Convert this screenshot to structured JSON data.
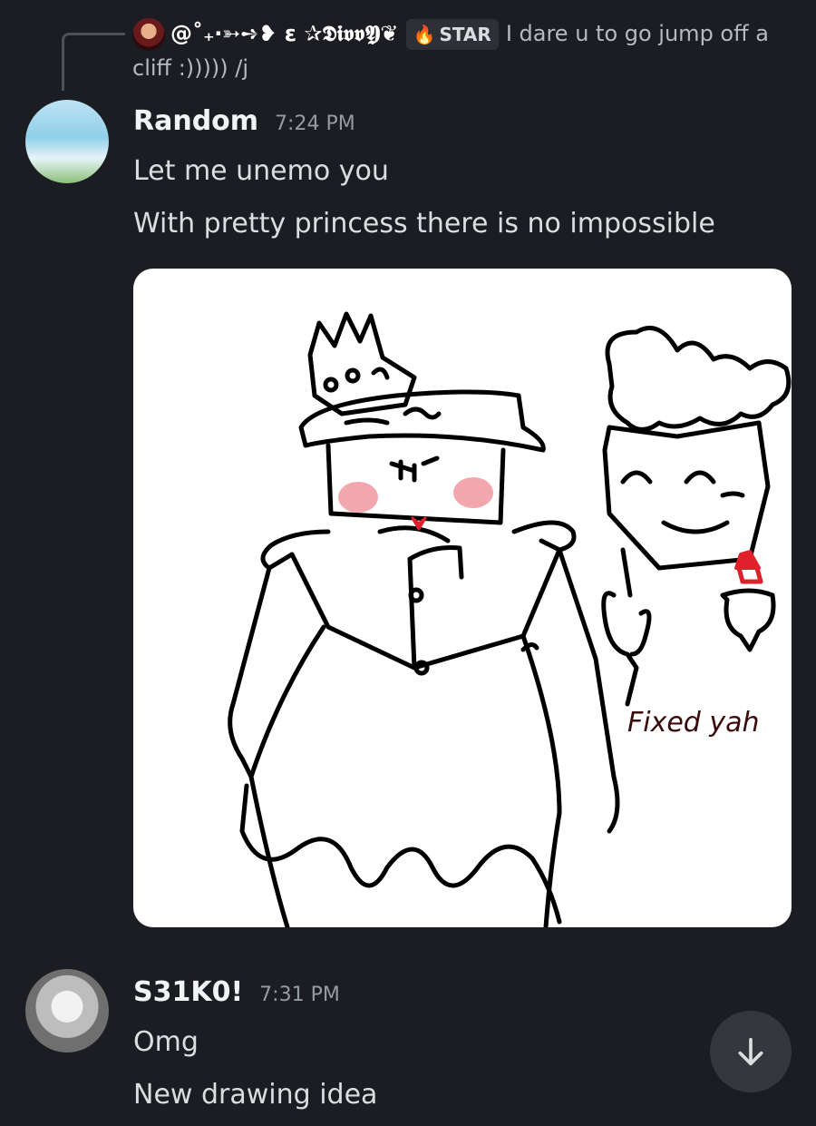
{
  "reply": {
    "author": "@˚₊‧➳➺❥ ε ✰𝕯𝖎𝖛𝖛𝖄❦",
    "tag": "STAR",
    "tag_icon": "flame-icon",
    "text": "I dare u to go jump off a cliff :))))) /j"
  },
  "messages": [
    {
      "author": "Random",
      "time": "7:24 PM",
      "lines": [
        "Let me unemo you",
        "With pretty princess there is no impossible"
      ],
      "attachment": "drawing-image"
    },
    {
      "author": "S31K0!",
      "time": "7:31 PM",
      "lines": [
        "Omg",
        "New drawing idea"
      ]
    }
  ],
  "drawing": {
    "caption": "Fixed yah"
  },
  "controls": {
    "scroll_icon": "arrow-down-icon"
  },
  "colors": {
    "background": "#1c1d22",
    "author": "#f2f3f5",
    "timestamp": "#949ba4",
    "text": "#dbdee1",
    "tag_icon": "#f0b232"
  }
}
